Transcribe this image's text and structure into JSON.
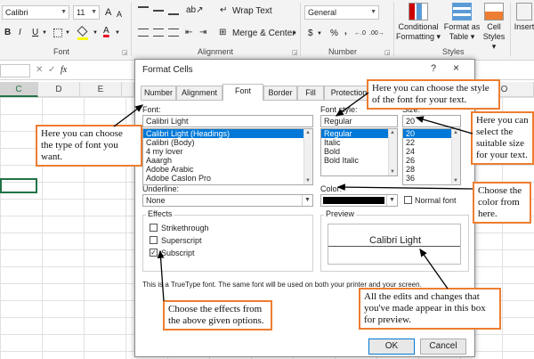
{
  "ribbon": {
    "font_name": "Calibri",
    "font_size": "11",
    "grow_font": "A",
    "shrink_font": "A",
    "bold": "B",
    "italic": "I",
    "underline": "U",
    "font_color_letter": "A",
    "wrap_text": "Wrap Text",
    "merge_center": "Merge & Center",
    "number_format": "General",
    "currency": "$",
    "percent": "%",
    "comma": ",",
    "conditional_formatting": [
      "Conditional",
      "Formatting"
    ],
    "format_as_table": [
      "Format as",
      "Table"
    ],
    "cell_styles": [
      "Cell",
      "Styles"
    ],
    "insert": "Insert",
    "groups": {
      "font": "Font",
      "alignment": "Alignment",
      "number": "Number",
      "styles": "Styles"
    }
  },
  "formula_bar": {
    "fx": "fx"
  },
  "columns": [
    "C",
    "D",
    "E",
    "O"
  ],
  "dialog": {
    "title": "Format Cells",
    "help": "?",
    "close": "×",
    "tabs": [
      "Number",
      "Alignment",
      "Font",
      "Border",
      "Fill",
      "Protection"
    ],
    "font_label": "Font:",
    "font_value": "Calibri Light",
    "font_list": [
      "Calibri Light (Headings)",
      "Calibri (Body)",
      "4 my lover",
      "Aaargh",
      "Adobe Arabic",
      "Adobe Caslon Pro"
    ],
    "style_label": "Font style:",
    "style_value": "Regular",
    "style_list": [
      "Regular",
      "Italic",
      "Bold",
      "Bold Italic"
    ],
    "size_label": "Size:",
    "size_value": "20",
    "size_list": [
      "20",
      "22",
      "24",
      "26",
      "28",
      "36"
    ],
    "underline_label": "Underline:",
    "underline_value": "None",
    "color_label": "Color:",
    "normal_font": "Normal font",
    "effects_label": "Effects",
    "effects": [
      {
        "label": "Strikethrough",
        "checked": false
      },
      {
        "label": "Superscript",
        "checked": false
      },
      {
        "label": "Subscript",
        "checked": true
      }
    ],
    "preview_label": "Preview",
    "preview_text": "Calibri Light",
    "info": "This is a TrueType font.  The same font will be used on both your printer and your screen.",
    "ok": "OK",
    "cancel": "Cancel"
  },
  "callouts": {
    "font": "Here you can choose the type of font you want.",
    "style": "Here you can choose the style of the font for your text.",
    "size": "Here you can select the suitable size for your text.",
    "color": "Choose the color from here.",
    "effects": "Choose the effects from the above given options.",
    "preview": "All the edits and changes that you've made appear in this box for preview."
  },
  "colors": {
    "accent": "#ed7d31",
    "selection": "#0078d7",
    "excel_green": "#217346",
    "font_red": "#e81123"
  }
}
